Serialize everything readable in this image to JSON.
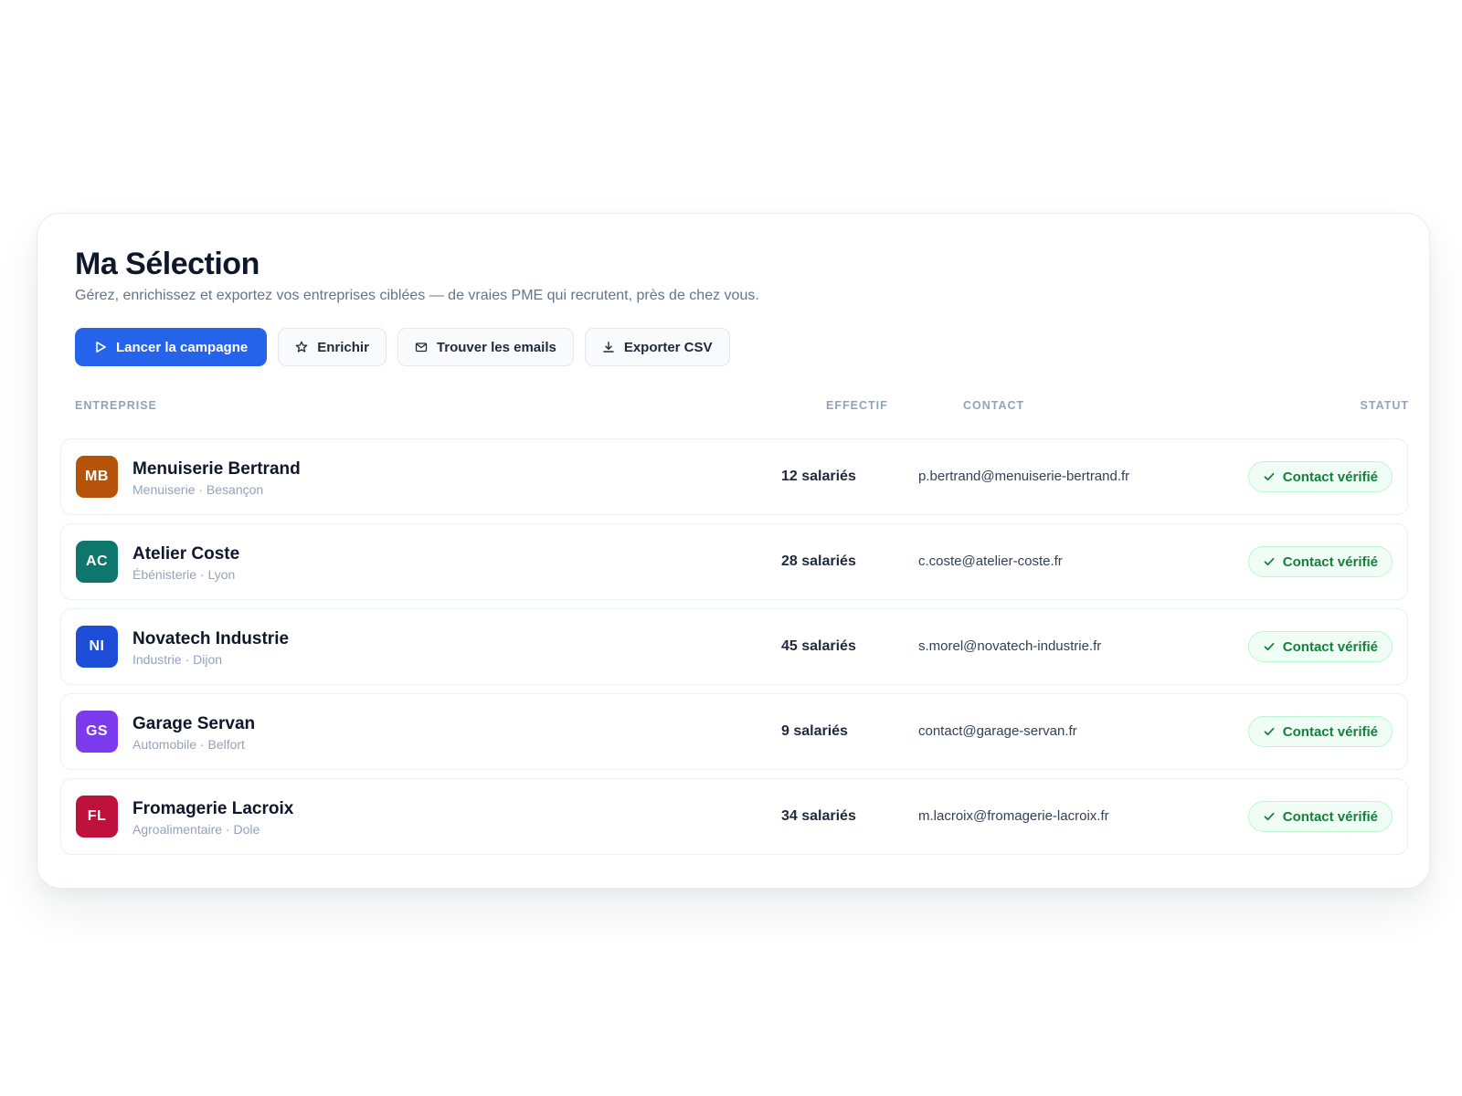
{
  "header": {
    "title": "Ma Sélection",
    "subtitle": "Gérez, enrichissez et exportez vos entreprises ciblées — de vraies PME qui recrutent, près de chez vous."
  },
  "toolbar": {
    "launch": {
      "label": "Lancer la campagne",
      "icon": "play-icon"
    },
    "enrich": {
      "label": "Enrichir",
      "icon": "star-icon"
    },
    "find_emails": {
      "label": "Trouver les emails",
      "icon": "mail-icon"
    },
    "export": {
      "label": "Exporter CSV",
      "icon": "download-icon"
    }
  },
  "table": {
    "columns": {
      "company": "ENTREPRISE",
      "size": "EFFECTIF",
      "contact": "CONTACT",
      "status": "STATUT"
    },
    "rows": [
      {
        "initials": "MB",
        "name": "Menuiserie Bertrand",
        "sector": "Menuiserie",
        "city": "Besançon",
        "meta": "Menuiserie · Besançon",
        "size": "12 salariés",
        "email": "p.bertrand@menuiserie-bertrand.fr",
        "status": "Contact vérifié",
        "color": "#b45309"
      },
      {
        "initials": "AC",
        "name": "Atelier Coste",
        "sector": "Ébénisterie",
        "city": "Lyon",
        "meta": "Ébénisterie · Lyon",
        "size": "28 salariés",
        "email": "c.coste@atelier-coste.fr",
        "status": "Contact vérifié",
        "color": "#0f766e"
      },
      {
        "initials": "NI",
        "name": "Novatech Industrie",
        "sector": "Industrie",
        "city": "Dijon",
        "meta": "Industrie · Dijon",
        "size": "45 salariés",
        "email": "s.morel@novatech-industrie.fr",
        "status": "Contact vérifié",
        "color": "#1d4ed8"
      },
      {
        "initials": "GS",
        "name": "Garage Servan",
        "sector": "Automobile",
        "city": "Belfort",
        "meta": "Automobile · Belfort",
        "size": "9 salariés",
        "email": "contact@garage-servan.fr",
        "status": "Contact vérifié",
        "color": "#7c3aed"
      },
      {
        "initials": "FL",
        "name": "Fromagerie Lacroix",
        "sector": "Agroalimentaire",
        "city": "Dole",
        "meta": "Agroalimentaire · Dole",
        "size": "34 salariés",
        "email": "m.lacroix@fromagerie-lacroix.fr",
        "status": "Contact vérifié",
        "color": "#be123c"
      }
    ]
  },
  "colors": {
    "primary": "#2563eb",
    "success": "#15803d",
    "success_bg": "#f0fdf4",
    "success_border": "#bbf7d0"
  }
}
